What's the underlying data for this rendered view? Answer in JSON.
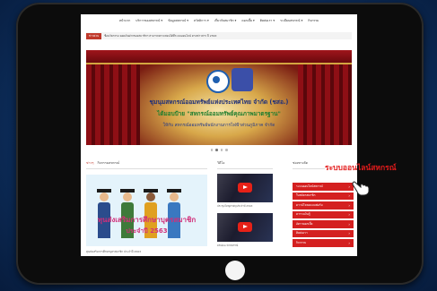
{
  "nav": {
    "items": [
      "หน้าแรก",
      "บริการของสหกรณ์ ▾",
      "ข้อมูลสหกรณ์ ▾",
      "สวัสดิการ ▾",
      "เกี่ยวกับสมาชิก ▾",
      "ดอกเบี้ย ▾",
      "ติดต่อเรา ▾",
      "ระเบียบสหกรณ์ ▾",
      "กิจกรรม"
    ]
  },
  "ticker": {
    "tag": "ข่าวด่วน",
    "text": "ชื่อนวัตกรรม ยอดเงินฝากของสมาชิกฯ สามารถตรวจสอบได้ที่ระบบออนไลน์ ตามข่าวสาร ปี 2563"
  },
  "banner": {
    "title": "ชุมนุมสหกรณ์ออมทรัพย์แห่งประเทศไทย จำกัด (ชสอ.)",
    "subtitle": "ได้มอบป้าย \"สหกรณ์ออมทรัพย์คุณภาพมาตรฐาน\"",
    "description": "ให้กับ สหกรณ์ออมทรัพย์พนักงานการไฟฟ้าส่วนภูมิภาค จำกัด"
  },
  "content": {
    "tabs": [
      "ข่าวๆ",
      "กิจกรรมสหกรณ์"
    ],
    "scholarship": {
      "line1": "ทุนส่งเสริมการศึกษาบุตรสมาชิก",
      "line2": "ประจำปี 2563"
    },
    "caption": "ทุนส่งเสริมการศึกษาบุตรสมาชิก ประจำปี 2563"
  },
  "video": {
    "heading": "วิดีโอ",
    "captions": [
      "ประชุมใหญ่สามัญประจำปี 2563",
      "คลิปแนะนำสหกรณ์"
    ]
  },
  "services": {
    "heading": "ช่องทางลัด",
    "callout": "ระบบออนไลน์สหกรณ์",
    "items": [
      "ระบบออนไลน์สหกรณ์",
      "ใบสมัครสมาชิก",
      "ดาวน์โหลดแบบฟอร์ม",
      "ตารางเงินกู้",
      "อัตราดอกเบี้ย",
      "ติดต่อเรา",
      "กิจกรรม"
    ],
    "arrow": "›"
  },
  "colors": {
    "accent": "#d42020",
    "callout": "#e31b1b",
    "banner_title": "#1c2e7a",
    "banner_subtitle": "#1e7d2e",
    "scholarship": "#d22f7a"
  }
}
